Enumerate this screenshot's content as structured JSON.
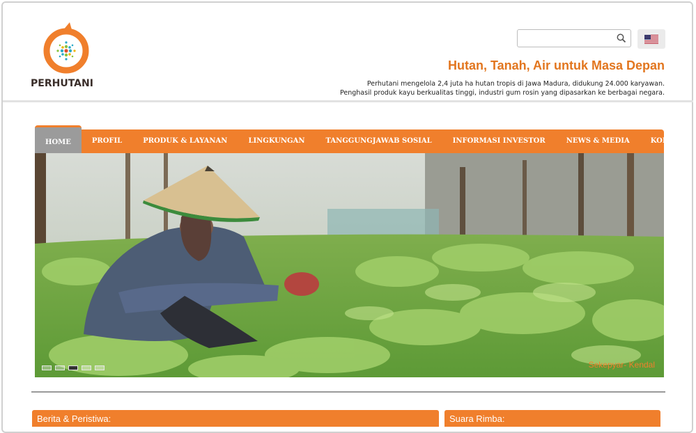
{
  "brand": {
    "name": "PERHUTANI",
    "accent_color": "#f07f2c"
  },
  "header": {
    "search": {
      "value": "",
      "placeholder": ""
    },
    "language_icon": "us-flag-icon",
    "tagline": "Hutan, Tanah, Air untuk Masa Depan",
    "description_lines": [
      "Perhutani mengelola 2,4 juta ha hutan tropis di Jawa Madura, didukung 24.000 karyawan.",
      "Penghasil produk kayu berkualitas tinggi, industri gum rosin yang dipasarkan ke berbagai negara."
    ]
  },
  "nav": {
    "items": [
      {
        "label": "HOME",
        "active": true
      },
      {
        "label": "PROFIL"
      },
      {
        "label": "PRODUK & LAYANAN"
      },
      {
        "label": "LINGKUNGAN"
      },
      {
        "label": "TANGGUNGJAWAB SOSIAL"
      },
      {
        "label": "INFORMASI INVESTOR"
      },
      {
        "label": "NEWS & MEDIA"
      },
      {
        "label": "KONTAK"
      }
    ]
  },
  "slider": {
    "caption": "Sekepyar- Kendal",
    "slide_count": 5,
    "active_slide": 3
  },
  "panels": {
    "left_title": "Berita & Peristiwa:",
    "right_title": "Suara Rimba:"
  }
}
